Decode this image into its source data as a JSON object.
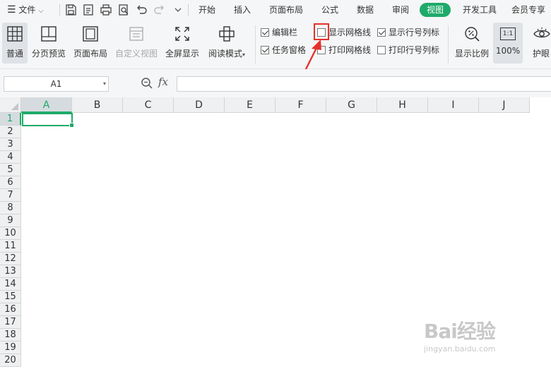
{
  "menubar": {
    "file_label": "文件",
    "tabs": [
      {
        "label": "开始",
        "active": false
      },
      {
        "label": "插入",
        "active": false
      },
      {
        "label": "页面布局",
        "active": false
      },
      {
        "label": "公式",
        "active": false
      },
      {
        "label": "数据",
        "active": false
      },
      {
        "label": "审阅",
        "active": false
      },
      {
        "label": "视图",
        "active": true
      },
      {
        "label": "开发工具",
        "active": false
      },
      {
        "label": "会员专享",
        "active": false
      }
    ]
  },
  "ribbon": {
    "normal": "普通",
    "page_break_preview": "分页预览",
    "page_layout": "页面布局",
    "custom_view": "自定义视图",
    "full_screen": "全屏显示",
    "reading_mode": "阅读模式",
    "checkboxes": {
      "formula_bar": {
        "label": "编辑栏",
        "checked": true
      },
      "task_pane": {
        "label": "任务窗格",
        "checked": true
      },
      "show_gridlines": {
        "label": "显示网格线",
        "checked": false
      },
      "print_gridlines": {
        "label": "打印网格线",
        "checked": false
      },
      "show_headers": {
        "label": "显示行号列标",
        "checked": true
      },
      "print_headers": {
        "label": "打印行号列标",
        "checked": false
      }
    },
    "zoom_ratio": "显示比例",
    "zoom_100": "100%",
    "zoom_100_icon_text": "1:1",
    "eye_protection": "护眼"
  },
  "formula_bar": {
    "name_box": "A1",
    "fx_label": "fx",
    "formula": ""
  },
  "grid": {
    "columns": [
      "A",
      "B",
      "C",
      "D",
      "E",
      "F",
      "G",
      "H",
      "I",
      "J"
    ],
    "rows": [
      "1",
      "2",
      "3",
      "4",
      "5",
      "6",
      "7",
      "8",
      "9",
      "10",
      "11",
      "12",
      "13",
      "14",
      "15",
      "16",
      "17",
      "18",
      "19",
      "20"
    ],
    "active_cell": "A1"
  },
  "watermark": {
    "text": "Bai经验",
    "url_text": "jingyan.baidu.com"
  },
  "colors": {
    "accent": "#1eaa6a",
    "highlight": "#e5312c"
  }
}
